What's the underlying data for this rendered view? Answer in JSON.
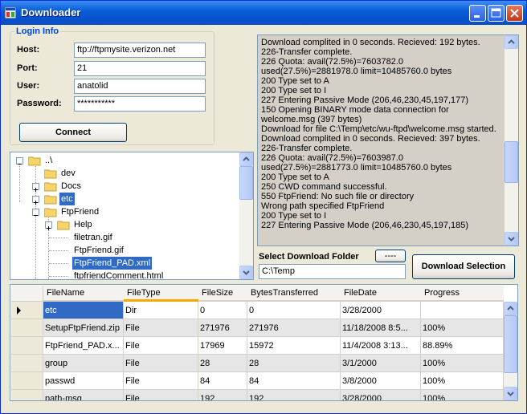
{
  "window": {
    "title": "Downloader"
  },
  "login": {
    "group_label": "Login Info",
    "host_label": "Host:",
    "host_value": "ftp://ftpmysite.verizon.net",
    "port_label": "Port:",
    "port_value": "21",
    "user_label": "User:",
    "user_value": "anatolid",
    "password_label": "Password:",
    "password_value": "***********",
    "connect_label": "Connect"
  },
  "tree": {
    "nodes": [
      {
        "label": "..\\",
        "expander": "minus",
        "selected": false
      },
      {
        "label": "dev",
        "expander": "",
        "selected": false
      },
      {
        "label": "Docs",
        "expander": "plus",
        "selected": false
      },
      {
        "label": "etc",
        "expander": "plus",
        "selected": false
      },
      {
        "label": "FtpFriend",
        "expander": "minus",
        "selected": false
      },
      {
        "label": "Help",
        "expander": "plus",
        "selected": false
      },
      {
        "label": "filetran.gif",
        "expander": "",
        "selected": false
      },
      {
        "label": "FtpFriend.gif",
        "expander": "",
        "selected": false
      },
      {
        "label": "FtpFriend_PAD.xml",
        "expander": "",
        "selected": true
      },
      {
        "label": "ftpfriendComment.html",
        "expander": "",
        "selected": false
      }
    ]
  },
  "log": {
    "text": "Download complited in 0 seconds. Recieved: 192 bytes.\n226-Transfer complete.\n226 Quota: avail(72.5%)=7603782.0 used(27.5%)=2881978.0 limit=10485760.0 bytes\n200 Type set to A\n200 Type set to I\n227 Entering Passive Mode (206,46,230,45,197,177)\n150 Opening BINARY mode data connection for welcome.msg (397 bytes)\nDownload for file C:\\Temp\\etc/wu-ftpd\\welcome.msg started.\nDownload complited in 0 seconds. Recieved: 397 bytes.\n226-Transfer complete.\n226 Quota: avail(72.5%)=7603987.0 used(27.5%)=2881773.0 limit=10485760.0 bytes\n200 Type set to A\n250 CWD command successful.\n550 FtpFriend: No such file or directory\nWrong path specified FtpFriend\n200 Type set to I\n227 Entering Passive Mode (206,46,230,45,197,185)"
  },
  "download": {
    "folder_label": "Select Download Folder",
    "browse_label": "----",
    "folder_value": "C:\\Temp",
    "button_label": "Download Selection"
  },
  "grid": {
    "columns": [
      "FileName",
      "FileType",
      "FileSize",
      "BytesTransferred",
      "FileDate",
      "Progress"
    ],
    "rows": [
      {
        "name": "etc",
        "type": "Dir",
        "size": "0",
        "bytes": "0",
        "date": "3/28/2000",
        "progress": "",
        "current": true
      },
      {
        "name": "SetupFtpFriend.zip",
        "type": "File",
        "size": "271976",
        "bytes": "271976",
        "date": "11/18/2008 8:5...",
        "progress": "100%",
        "current": false
      },
      {
        "name": "FtpFriend_PAD.x...",
        "type": "File",
        "size": "17969",
        "bytes": "15972",
        "date": "11/4/2008 3:13...",
        "progress": "88.89%",
        "current": false
      },
      {
        "name": "group",
        "type": "File",
        "size": "28",
        "bytes": "28",
        "date": "3/1/2000",
        "progress": "100%",
        "current": false
      },
      {
        "name": "passwd",
        "type": "File",
        "size": "84",
        "bytes": "84",
        "date": "3/8/2000",
        "progress": "100%",
        "current": false
      },
      {
        "name": "path-msg",
        "type": "File",
        "size": "192",
        "bytes": "192",
        "date": "3/28/2000",
        "progress": "100%",
        "current": false
      }
    ]
  },
  "colors": {
    "accent": "#316ac5",
    "title_bar": "#0a5fd8",
    "group_label": "#0046d5"
  },
  "icons": [
    "app-icon",
    "minimize-icon",
    "maximize-icon",
    "close-icon",
    "folder-icon",
    "file-icon",
    "scroll-up-icon",
    "scroll-down-icon",
    "row-pointer-icon"
  ]
}
